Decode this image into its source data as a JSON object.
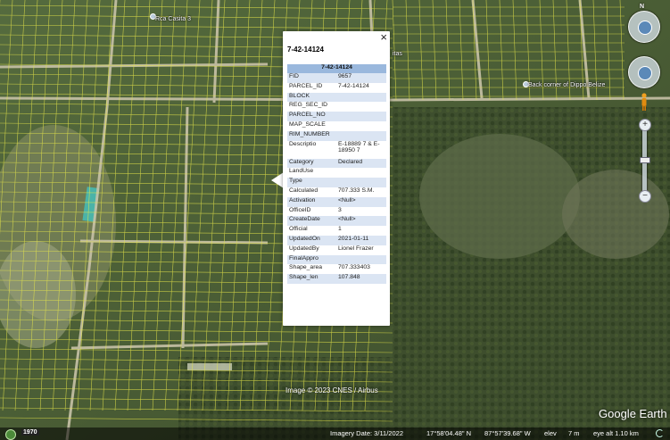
{
  "map": {
    "place_labels": [
      "Rca Casita 3",
      "Back corner of Dippo Belize",
      "itas"
    ]
  },
  "popup": {
    "title": "7-42-14124",
    "close_label": "×",
    "table_header": "7-42-14124",
    "rows": [
      {
        "key": "FID",
        "value": "9657"
      },
      {
        "key": "PARCEL_ID",
        "value": "7-42-14124"
      },
      {
        "key": "BLOCK",
        "value": ""
      },
      {
        "key": "REG_SEC_ID",
        "value": ""
      },
      {
        "key": "PARCEL_NO",
        "value": ""
      },
      {
        "key": "MAP_SCALE",
        "value": ""
      },
      {
        "key": "RIM_NUMBER",
        "value": ""
      },
      {
        "key": "Descriptio",
        "value": "E-18889 7 & E-18950 7"
      },
      {
        "key": "Category",
        "value": "Declared"
      },
      {
        "key": "LandUse",
        "value": ""
      },
      {
        "key": "Type",
        "value": ""
      },
      {
        "key": "Calculated",
        "value": "707.333 S.M."
      },
      {
        "key": "Activation",
        "value": "<Null>"
      },
      {
        "key": "OfficeID",
        "value": "3"
      },
      {
        "key": "CreateDate",
        "value": "<Null>"
      },
      {
        "key": "Official",
        "value": "1"
      },
      {
        "key": "UpdatedOn",
        "value": "2021-01-11"
      },
      {
        "key": "UpdatedBy",
        "value": "Lionel Frazer"
      },
      {
        "key": "FinalAppro",
        "value": ""
      },
      {
        "key": "Shape_area",
        "value": "707.333403"
      },
      {
        "key": "Shape_len",
        "value": "107.848"
      }
    ]
  },
  "controls": {
    "north_label": "N",
    "zoom_in": "+",
    "zoom_out": "−"
  },
  "overlay": {
    "copyright": "Image © 2023 CNES / Airbus",
    "logo": "Google Earth"
  },
  "status": {
    "year": "1970",
    "imagery_date": "Imagery Date: 3/11/2022",
    "lat": "17°58'04.48\" N",
    "lon": "87°57'39.68\" W",
    "elev_label": "elev",
    "elev_value": "7 m",
    "eye_alt": "eye alt  1.10 km"
  },
  "colors": {
    "parcel_line": "#e6e64a",
    "popup_header": "#9ab8dd",
    "popup_stripe": "#dbe5f3"
  }
}
